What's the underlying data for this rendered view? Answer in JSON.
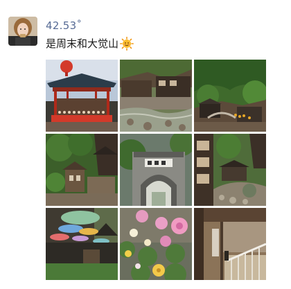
{
  "post": {
    "author": "42.53˚",
    "text": "是周末和大觉山",
    "emoji": "smiling-sun-emoji"
  },
  "gallery": {
    "count": 9,
    "photos": [
      "red-lantern-pavilion-photo",
      "riverside-houses-photo",
      "mountain-valley-village-photo",
      "wooden-houses-forest-photo",
      "stone-arch-gate-photo",
      "cliff-village-photo",
      "umbrella-decor-courtyard-photo",
      "pink-flowers-photo",
      "wooden-staircase-interior-photo"
    ]
  }
}
